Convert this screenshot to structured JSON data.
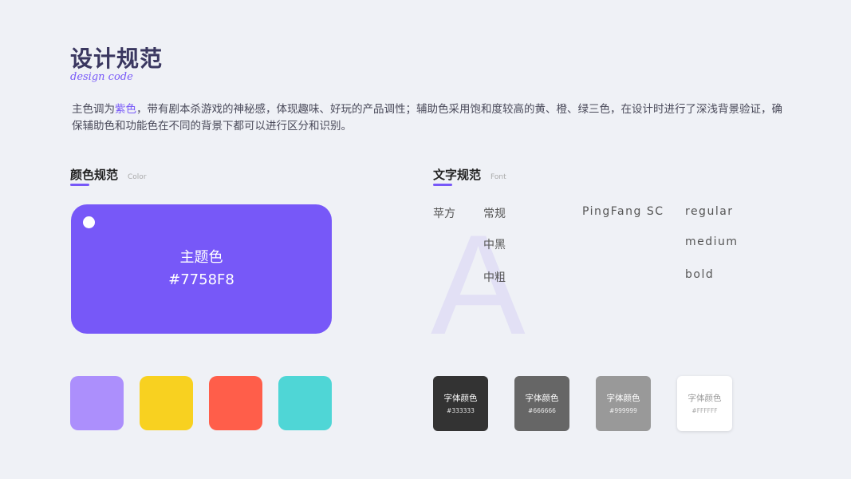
{
  "header": {
    "title": "设计规范",
    "subtitle": "design code"
  },
  "intro": {
    "part1": "主色调为",
    "accent": "紫色",
    "part2": "，带有剧本杀游戏的神秘感，体现趣味、好玩的产品调性；辅助色采用饱和度较高的黄、橙、绿三色，在设计时进行了深浅背景验证，确保辅助色和功能色在不同的背景下都可以进行区分和识别。"
  },
  "color_section": {
    "title": "颜色规范",
    "title_en": "Color",
    "main": {
      "name": "主题色",
      "hex": "#7758F8",
      "color": "#7758f8"
    },
    "secondary": [
      "#ac8ffc",
      "#f8d120",
      "#ff5e4a",
      "#4fd6d6"
    ]
  },
  "font_section": {
    "title": "文字规范",
    "title_en": "Font",
    "bg_letter": "A",
    "family_zh": "苹方",
    "family_en": "PingFang SC",
    "weights": [
      {
        "zh": "常规",
        "en": "regular"
      },
      {
        "zh": "中黑",
        "en": "medium"
      },
      {
        "zh": "中粗",
        "en": "bold"
      }
    ],
    "text_colors": [
      {
        "label": "字体颜色",
        "hex": "#333333",
        "bg": "#333333",
        "fg": "#ffffff"
      },
      {
        "label": "字体颜色",
        "hex": "#666666",
        "bg": "#666666",
        "fg": "#ffffff"
      },
      {
        "label": "字体颜色",
        "hex": "#999999",
        "bg": "#999999",
        "fg": "#ffffff"
      },
      {
        "label": "字体颜色",
        "hex": "#FFFFFF",
        "bg": "#ffffff",
        "fg": "#999999"
      }
    ]
  }
}
